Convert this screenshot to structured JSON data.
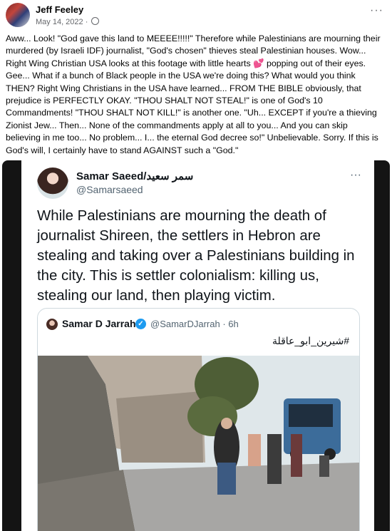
{
  "post": {
    "author": "Jeff Feeley",
    "date": "May 14, 2022",
    "privacy_separator": "·",
    "more_icon": "more-horizontal-icon",
    "text": "Aww... Look! \"God gave this land to MEEEE!!!!!\" Therefore while Palestinians are mourning their murdered (by Israeli IDF) journalist, \"God's chosen\" thieves steal Palestinian houses. Wow... Right Wing Christian USA looks at this footage with little hearts 💕 popping out of their eyes. Gee... What if a bunch of Black people in the USA we're doing this? What would you think THEN? Right Wing Christians in the USA have learned... FROM THE BIBLE obviously, that prejudice is PERFECTLY OKAY. \"THOU SHALT NOT STEAL!\" is one of God's 10 Commandments! \"THOU SHALT NOT KILL!\" is another one. \"Uh... EXCEPT if you're a thieving Zionist Jew... Then... None of the commandments apply at all to you... And you can skip believing in me too... No problem... I... the eternal God decree so!\" Unbelievable. Sorry. If this is God's will, I certainly have to stand AGAINST such a \"God.\""
  },
  "tweet": {
    "name": "Samar Saeed/سمر سعيد",
    "handle": "@Samarsaeed",
    "more": "···",
    "text": "While Palestinians are mourning the death of journalist Shireen, the settlers in Hebron are stealing and taking over a Palestinians building in the city. This is settler colonialism: killing us, stealing our land, then playing victim."
  },
  "quote": {
    "name": "Samar D Jarrah",
    "verified": "✓",
    "handle_time": "@SamarDJarrah · 6h",
    "hashtag": "#شيرين_ابو_عاقلة"
  },
  "colors": {
    "verified": "#1d9bf0",
    "bus": "#3c6c9a",
    "sky": "#dfe7ea"
  }
}
